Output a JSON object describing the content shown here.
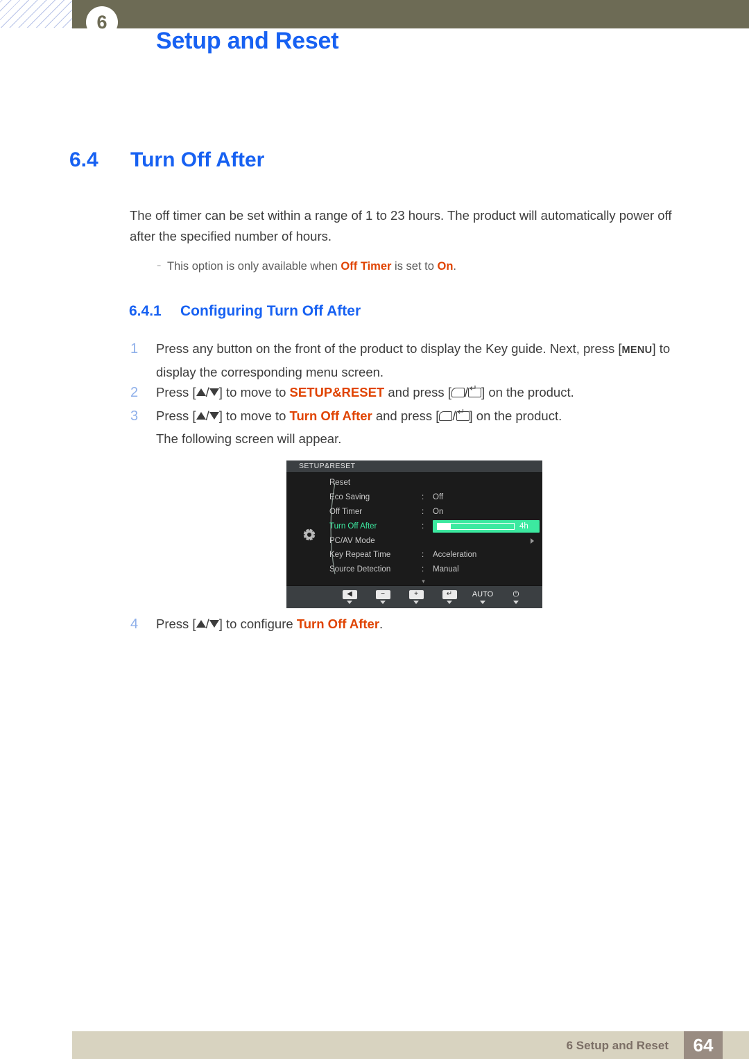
{
  "header": {
    "chapter_number": "6",
    "title": "Setup and Reset"
  },
  "section": {
    "number": "6.4",
    "title": "Turn Off After"
  },
  "intro_paragraph": "The off timer can be set within a range of 1 to 23 hours. The product will automatically power off after the specified number of hours.",
  "note": {
    "text_before": "This option is only available when ",
    "highlight_1": "Off Timer",
    "text_middle": " is set to ",
    "highlight_2": "On",
    "text_after": "."
  },
  "subsection": {
    "number": "6.4.1",
    "title": "Configuring Turn Off After"
  },
  "steps": [
    {
      "num": "1",
      "p1": "Press any button on the front of the product to display the Key guide. Next, press [",
      "key": "MENU",
      "p2": "] to display the corresponding menu screen."
    },
    {
      "num": "2",
      "p1": "Press [",
      "arrows": "/",
      "p2": "] to move to ",
      "highlight": "SETUP&RESET",
      "p3": " and press [",
      "keys": "/",
      "p4": "] on the product."
    },
    {
      "num": "3",
      "p1": "Press [",
      "arrows": "/",
      "p2": "] to move to ",
      "highlight": "Turn Off After",
      "p3": " and press [",
      "keys": "/",
      "p4": "] on the product.",
      "sub": "The following screen will appear."
    },
    {
      "num": "4",
      "p1": "Press [",
      "arrows": "/",
      "p2": "] to configure ",
      "highlight": "Turn Off After",
      "p3": "."
    }
  ],
  "osd": {
    "title": "SETUP&RESET",
    "colon": ":",
    "more_indicator": "▾",
    "rows": [
      {
        "label": "Reset",
        "value": "",
        "has_colon": false,
        "type": "plain"
      },
      {
        "label": "Eco Saving",
        "value": "Off",
        "has_colon": true,
        "type": "plain"
      },
      {
        "label": "Off Timer",
        "value": "On",
        "has_colon": true,
        "type": "plain"
      },
      {
        "label": "Turn Off After",
        "value": "4h",
        "has_colon": true,
        "type": "slider",
        "selected": true,
        "slider_percent": 17
      },
      {
        "label": "PC/AV Mode",
        "value": "",
        "has_colon": false,
        "type": "submenu"
      },
      {
        "label": "Key Repeat Time",
        "value": "Acceleration",
        "has_colon": true,
        "type": "plain"
      },
      {
        "label": "Source Detection",
        "value": "Manual",
        "has_colon": true,
        "type": "plain"
      }
    ],
    "keys": [
      {
        "name": "back-key",
        "glyph": "◀"
      },
      {
        "name": "minus-key",
        "glyph": "−"
      },
      {
        "name": "plus-key",
        "glyph": "+"
      },
      {
        "name": "enter-key",
        "glyph": "↵"
      },
      {
        "name": "auto-key",
        "glyph": "AUTO"
      },
      {
        "name": "power-key",
        "glyph": "⏻"
      }
    ]
  },
  "footer": {
    "text": "6 Setup and Reset",
    "page": "64"
  },
  "colors": {
    "heading_blue": "#1761f2",
    "highlight_orange": "#e04403",
    "osd_green": "#3ce9a0",
    "header_olive": "#6d6b55",
    "footer_band": "#d8d3c0",
    "footer_page_box": "#998c82"
  }
}
